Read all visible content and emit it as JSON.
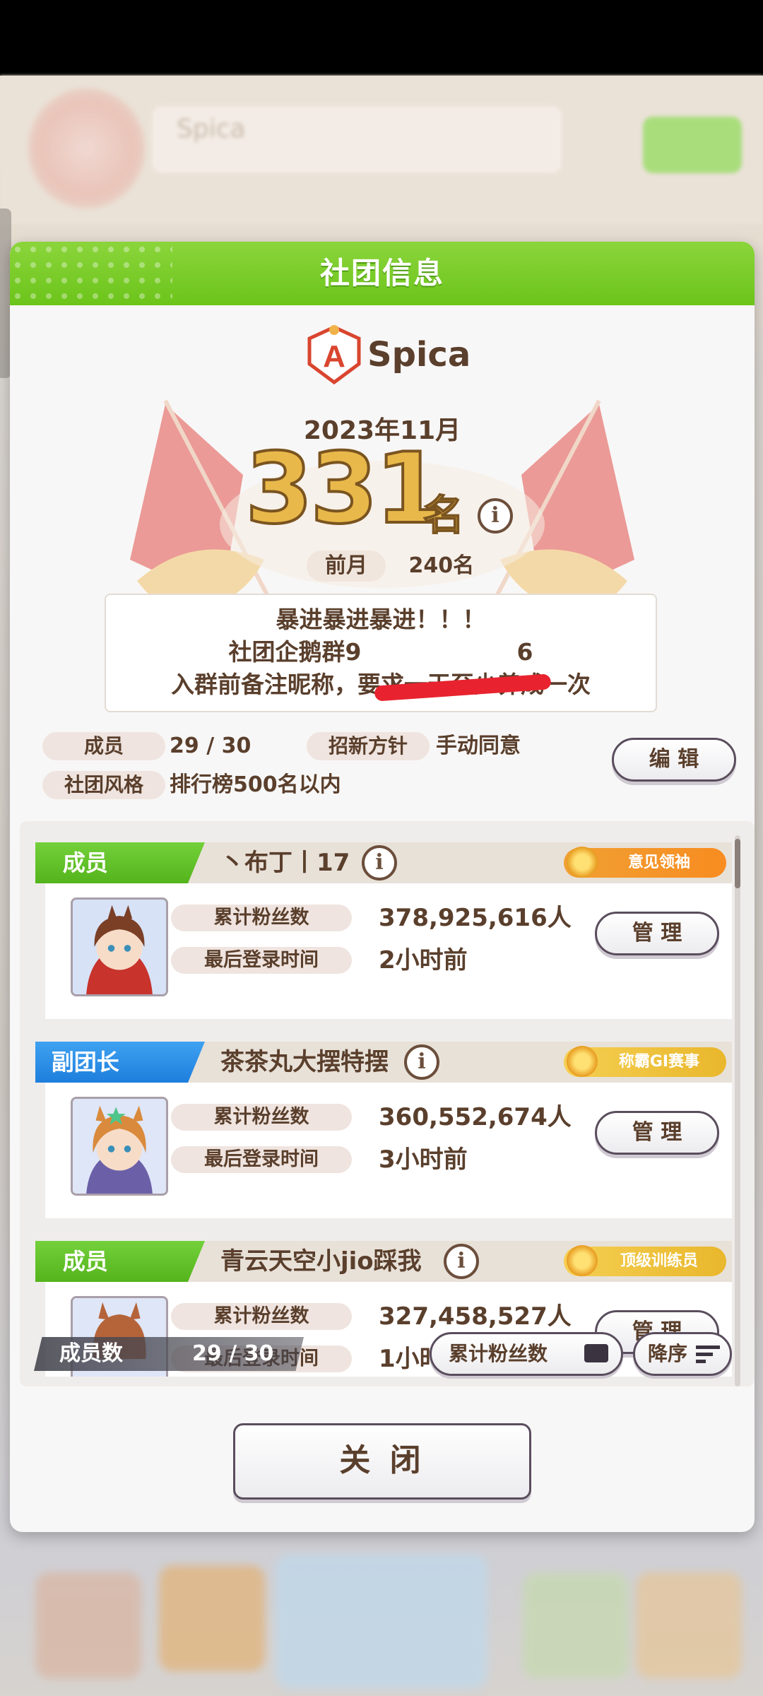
{
  "dialog": {
    "title": "社团信息",
    "club_name": "Spica",
    "rank_month": "2023年11月",
    "rank_number": "331",
    "rank_unit": "名",
    "prev_month_label": "前月",
    "prev_month_value": "240名",
    "description_lines": [
      "暴进暴进暴进！！！",
      "社团企鹅群9",
      "入群前备注昵称，要求一天至少养成一次"
    ],
    "description_redacted_tail": "6",
    "members_label": "成员",
    "members_value": "29 / 30",
    "recruit_label": "招新方针",
    "recruit_value": "手动同意",
    "style_label": "社团风格",
    "style_value": "排行榜500名以内",
    "edit_button": "编 辑",
    "close_button": "关 闭"
  },
  "members": [
    {
      "role": "成员",
      "name": "丶布丁丨17",
      "title": "意见领袖",
      "fans_label": "累计粉丝数",
      "fans": "378,925,616人",
      "login_label": "最后登录时间",
      "login": "2小时前",
      "manage": "管 理"
    },
    {
      "role": "副团长",
      "name": "茶茶丸大摆特摆",
      "title": "称霸GⅠ赛事",
      "fans_label": "累计粉丝数",
      "fans": "360,552,674人",
      "login_label": "最后登录时间",
      "login": "3小时前",
      "manage": "管 理"
    },
    {
      "role": "成员",
      "name": "青云天空小jio踩我",
      "title": "顶级训练员",
      "fans_label": "累计粉丝数",
      "fans": "327,458,527人",
      "login_label": "最后登录时间",
      "login": "1小时前",
      "manage": "管 理"
    }
  ],
  "list_footer": {
    "count_label": "成员数",
    "count_value": "29 / 30",
    "sort_key": "累计粉丝数",
    "sort_order": "降序"
  },
  "colors": {
    "header_green": "#6cc41a",
    "member_tag": "#54b41c",
    "vice_tag": "#1d7edd",
    "text_brown": "#5a3f2c",
    "rank_gold": "#e8b84a"
  }
}
